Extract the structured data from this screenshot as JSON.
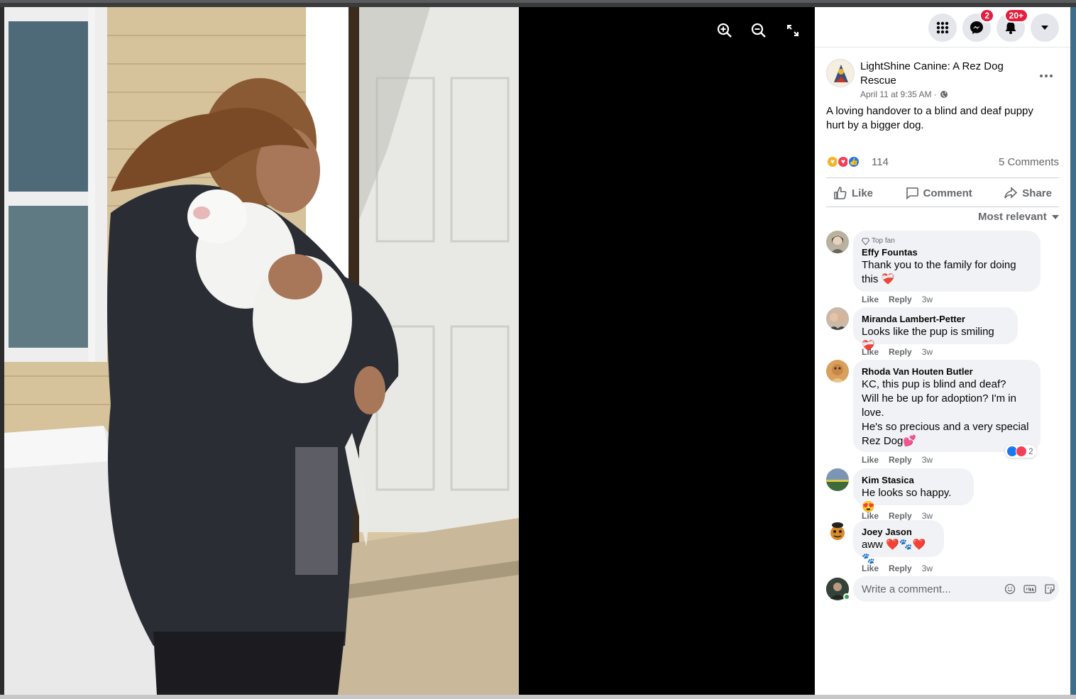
{
  "topbar": {
    "menu_icon": "grid-menu-icon",
    "messenger_badge": "2",
    "notifications_badge": "20+"
  },
  "post": {
    "page_name": "LightShine Canine: A Rez Dog Rescue",
    "timestamp": "April 11 at 9:35 AM · ",
    "text": "A loving handover to a blind and deaf puppy hurt by a bigger dog.",
    "reaction_count": "114",
    "comments_count": "5 Comments"
  },
  "actions": {
    "like": "Like",
    "comment": "Comment",
    "share": "Share"
  },
  "sort_label": "Most relevant",
  "comments": [
    {
      "name": "Effy Fountas",
      "badge": "Top fan",
      "text": "Thank you to the family for doing this ❤️‍🩹",
      "like": "Like",
      "reply": "Reply",
      "time": "3w"
    },
    {
      "name": "Miranda Lambert-Petter",
      "text": "Looks like the pup is smiling ❤️‍🩹",
      "like": "Like",
      "reply": "Reply",
      "time": "3w"
    },
    {
      "name": "Rhoda Van Houten Butler",
      "text_lines": [
        "KC, this pup is blind and deaf?",
        "Will he be up for adoption? I'm in",
        "love.",
        "He's so precious and a very special",
        "Rez Dog💕"
      ],
      "reaction_count": "2",
      "like": "Like",
      "reply": "Reply",
      "time": "3w"
    },
    {
      "name": "Kim Stasica",
      "text": "He looks so happy. 😍",
      "like": "Like",
      "reply": "Reply",
      "time": "3w"
    },
    {
      "name": "Joey Jason",
      "text": "aww ❤️🐾❤️🐾",
      "like": "Like",
      "reply": "Reply",
      "time": "3w"
    }
  ],
  "composer": {
    "placeholder": "Write a comment..."
  },
  "colors": {
    "like_blue": "#1877f2",
    "love_red": "#f33e58",
    "badge_red": "#e41e3f"
  }
}
